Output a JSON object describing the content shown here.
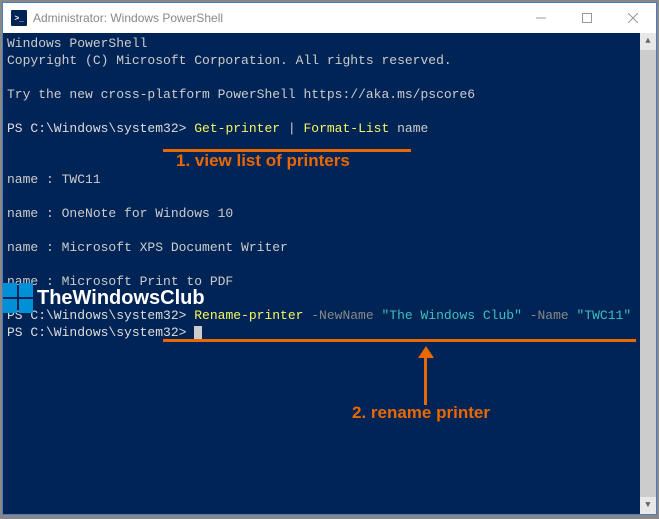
{
  "window": {
    "title": "Administrator: Windows PowerShell"
  },
  "terminal": {
    "header1": "Windows PowerShell",
    "header2": "Copyright (C) Microsoft Corporation. All rights reserved.",
    "tryline": "Try the new cross-platform PowerShell https://aka.ms/pscore6",
    "prompt": "PS C:\\Windows\\system32> ",
    "cmd1_a": "Get-printer",
    "cmd1_pipe": " | ",
    "cmd1_b": "Format-List",
    "cmd1_c": " name",
    "out1": "name : TWC11",
    "out2": "name : OneNote for Windows 10",
    "out3": "name : Microsoft XPS Document Writer",
    "out4": "name : Microsoft Print to PDF",
    "cmd2_a": "Rename-printer",
    "cmd2_p1": " -NewName ",
    "cmd2_v1": "\"The Windows Club\"",
    "cmd2_p2": " -Name ",
    "cmd2_v2": "\"TWC11\""
  },
  "annotations": {
    "step1": "1. view list of printers",
    "step2": "2. rename printer"
  },
  "logo": {
    "text": "TheWindowsClub"
  }
}
